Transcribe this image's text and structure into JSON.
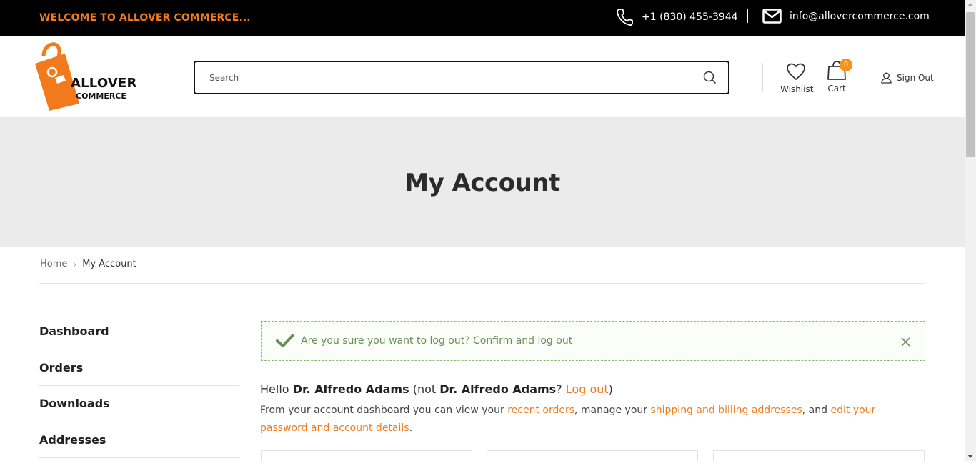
{
  "topbar": {
    "welcome": "WELCOME TO ALLOVER COMMERCE...",
    "phone": "+1 (830) 455-3944",
    "email": "info@allovercommerce.com"
  },
  "header": {
    "brand_line1": "ALLOVER",
    "brand_line2": "COMMERCE",
    "search_placeholder": "Search",
    "wishlist_label": "Wishlist",
    "cart_label": "Cart",
    "cart_count": "0",
    "signout_label": "Sign Out"
  },
  "hero": {
    "title": "My Account"
  },
  "breadcrumb": {
    "home": "Home",
    "current": "My Account"
  },
  "sidebar": {
    "items": [
      {
        "label": "Dashboard"
      },
      {
        "label": "Orders"
      },
      {
        "label": "Downloads"
      },
      {
        "label": "Addresses"
      }
    ]
  },
  "notice": {
    "message": "Are you sure you want to log out? Confirm and log out"
  },
  "greeting": {
    "hello": "Hello",
    "name": "Dr. Alfredo Adams",
    "not_prefix": "(not",
    "name2": "Dr. Alfredo Adams",
    "q": "?",
    "logout_link": "Log out",
    "close_paren": ")"
  },
  "intro": {
    "part1": "From your account dashboard you can view your",
    "link_orders": "recent orders",
    "part2": ", manage your",
    "link_addresses": "shipping and billing addresses",
    "part3": ", and",
    "link_account": "edit your password and account details",
    "part4": "."
  },
  "colors": {
    "accent": "#f27a1a",
    "success": "#6a8f56",
    "topbar_bg": "#000000",
    "hero_bg": "#ebebeb"
  },
  "icons": [
    "phone-icon",
    "envelope-icon",
    "logo-bag-icon",
    "search-icon",
    "heart-icon",
    "cart-bag-icon",
    "user-icon",
    "checkmark-icon",
    "close-icon"
  ]
}
